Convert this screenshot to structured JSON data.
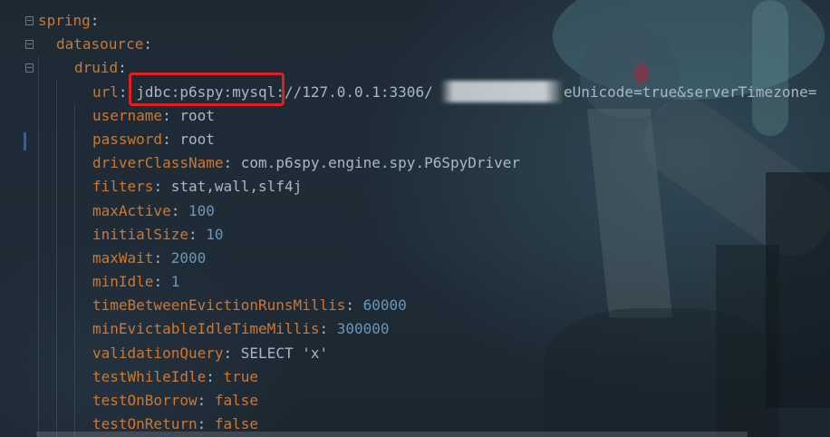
{
  "editor": {
    "language": "YAML",
    "colors": {
      "key": "#cc7832",
      "value": "#a9b7c6",
      "number": "#6897bb",
      "highlight_box": "#e02020"
    },
    "lines": [
      {
        "key": "spring",
        "value": "",
        "type": "none"
      },
      {
        "key": "datasource",
        "value": "",
        "type": "none"
      },
      {
        "key": "druid",
        "value": "",
        "type": "none"
      },
      {
        "key": "url",
        "value": "jdbc:p6spy:mysql://127.0.0.1:3306/",
        "value_tail": "eUnicode=true&serverTimezone=",
        "type": "string"
      },
      {
        "key": "username",
        "value": "root",
        "type": "string"
      },
      {
        "key": "password",
        "value": "root",
        "type": "string"
      },
      {
        "key": "driverClassName",
        "value": "com.p6spy.engine.spy.P6SpyDriver",
        "type": "string"
      },
      {
        "key": "filters",
        "value": "stat,wall,slf4j",
        "type": "string"
      },
      {
        "key": "maxActive",
        "value": "100",
        "type": "number"
      },
      {
        "key": "initialSize",
        "value": "10",
        "type": "number"
      },
      {
        "key": "maxWait",
        "value": "2000",
        "type": "number"
      },
      {
        "key": "minIdle",
        "value": "1",
        "type": "number"
      },
      {
        "key": "timeBetweenEvictionRunsMillis",
        "value": "60000",
        "type": "number"
      },
      {
        "key": "minEvictableIdleTimeMillis",
        "value": "300000",
        "type": "number"
      },
      {
        "key": "validationQuery",
        "value": "SELECT 'x'",
        "type": "string"
      },
      {
        "key": "testWhileIdle",
        "value": "true",
        "type": "bool"
      },
      {
        "key": "testOnBorrow",
        "value": "false",
        "type": "bool"
      },
      {
        "key": "testOnReturn",
        "value": "false",
        "type": "bool"
      }
    ]
  }
}
